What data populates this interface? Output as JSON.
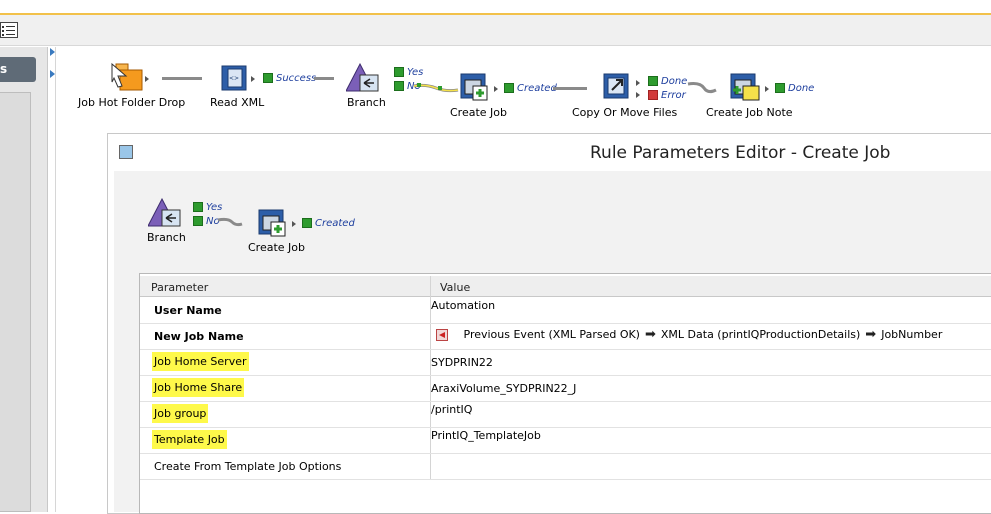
{
  "left_panel": {
    "tab_label": "s"
  },
  "workflow": {
    "nodes": [
      {
        "label": "Job Hot Folder Drop"
      },
      {
        "label": "Read XML"
      },
      {
        "label": "Branch"
      },
      {
        "label": "Create Job"
      },
      {
        "label": "Copy Or Move Files"
      },
      {
        "label": "Create Job Note"
      }
    ],
    "statuses": {
      "read_xml": "Success",
      "branch_yes": "Yes",
      "branch_no": "No",
      "create_job": "Created",
      "copy_done": "Done",
      "copy_error": "Error",
      "note_done": "Done"
    }
  },
  "editor": {
    "title": "Rule Parameters Editor - Create Job",
    "mini_flow": {
      "branch_label": "Branch",
      "yes": "Yes",
      "no": "No",
      "create_label": "Create Job",
      "created": "Created"
    },
    "table": {
      "headers": [
        "Parameter",
        "Value"
      ],
      "rows": [
        {
          "name": "User Name",
          "value": "Automation"
        },
        {
          "name": "New Job Name",
          "value_parts": [
            "Previous Event (XML Parsed OK)",
            "XML Data (printIQProductionDetails)",
            "JobNumber"
          ]
        },
        {
          "name": "Job Home Server",
          "value": "SYDPRIN22"
        },
        {
          "name": "Job Home Share",
          "value": "AraxiVolume_SYDPRIN22_J"
        },
        {
          "name": "Job group",
          "value": "/printIQ"
        },
        {
          "name": "Template Job",
          "value": "PrintIQ_TemplateJob"
        },
        {
          "name": "Create From Template Job Options",
          "value": ""
        }
      ]
    }
  },
  "colors": {
    "highlight": "#fef94a",
    "status_text": "#1e3f9e",
    "accent_top": "#f2c14a"
  }
}
